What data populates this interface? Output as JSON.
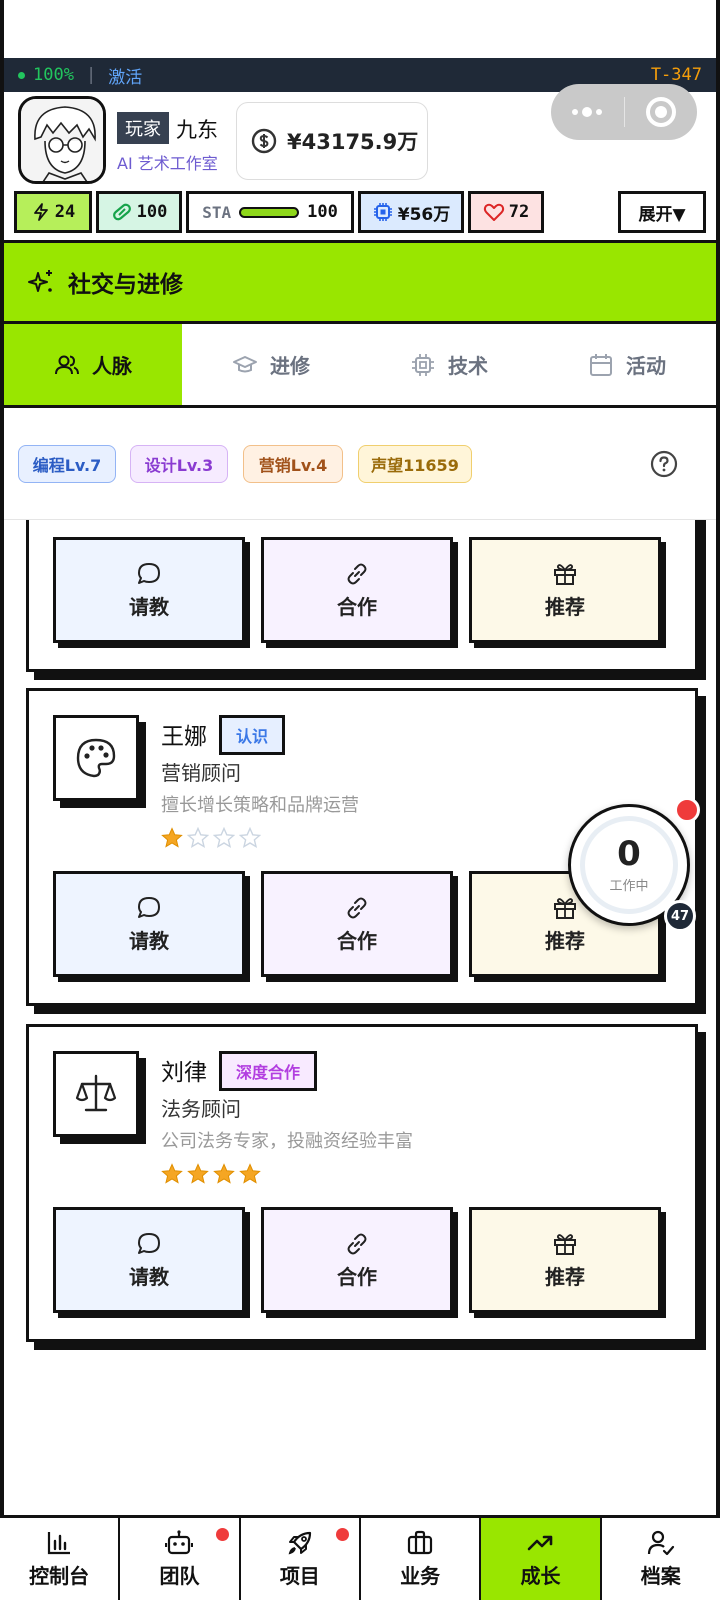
{
  "status_bar": {
    "battery": "100%",
    "activate": "激活",
    "tick": "T-347"
  },
  "profile": {
    "role_badge": "玩家",
    "name": "九东",
    "studio": "AI 艺术工作室",
    "money": "¥43175.9万"
  },
  "stats": {
    "energy": "24",
    "health": "100",
    "sta_label": "STA",
    "sta_value": "100",
    "sta_fill": 1.0,
    "chip": "¥56万",
    "heart": "72",
    "expand": "展开▼"
  },
  "section": {
    "title": "社交与进修"
  },
  "tabs": [
    {
      "label": "人脉",
      "icon": "users-icon",
      "active": true
    },
    {
      "label": "进修",
      "icon": "graduation-cap-icon",
      "active": false
    },
    {
      "label": "技术",
      "icon": "chip-icon",
      "active": false
    },
    {
      "label": "活动",
      "icon": "calendar-icon",
      "active": false
    }
  ],
  "skills": [
    "编程Lv.7",
    "设计Lv.3",
    "营销Lv.4",
    "声望11659"
  ],
  "actions": {
    "ask": "请教",
    "cooperate": "合作",
    "recommend": "推荐"
  },
  "contacts": [
    {
      "name": "王娜",
      "relation": "认识",
      "role": "营销顾问",
      "desc": "擅长增长策略和品牌运营",
      "stars": 1,
      "max_stars": 4,
      "icon": "palette-icon"
    },
    {
      "name": "刘律",
      "relation": "深度合作",
      "role": "法务顾问",
      "desc": "公司法务专家，投融资经验丰富",
      "stars": 4,
      "max_stars": 4,
      "icon": "scale-icon"
    }
  ],
  "float_widget": {
    "count": "0",
    "label": "工作中",
    "badge": "47"
  },
  "nav": [
    {
      "label": "控制台",
      "icon": "bar-chart-icon",
      "dot": false,
      "active": false
    },
    {
      "label": "团队",
      "icon": "robot-icon",
      "dot": true,
      "active": false
    },
    {
      "label": "项目",
      "icon": "rocket-icon",
      "dot": true,
      "active": false
    },
    {
      "label": "业务",
      "icon": "briefcase-icon",
      "dot": false,
      "active": false
    },
    {
      "label": "成长",
      "icon": "trending-up-icon",
      "dot": false,
      "active": true
    },
    {
      "label": "档案",
      "icon": "user-check-icon",
      "dot": false,
      "active": false
    }
  ],
  "colors": {
    "accent": "#99e600",
    "dark": "#1f2937",
    "star": "#f5a623"
  }
}
